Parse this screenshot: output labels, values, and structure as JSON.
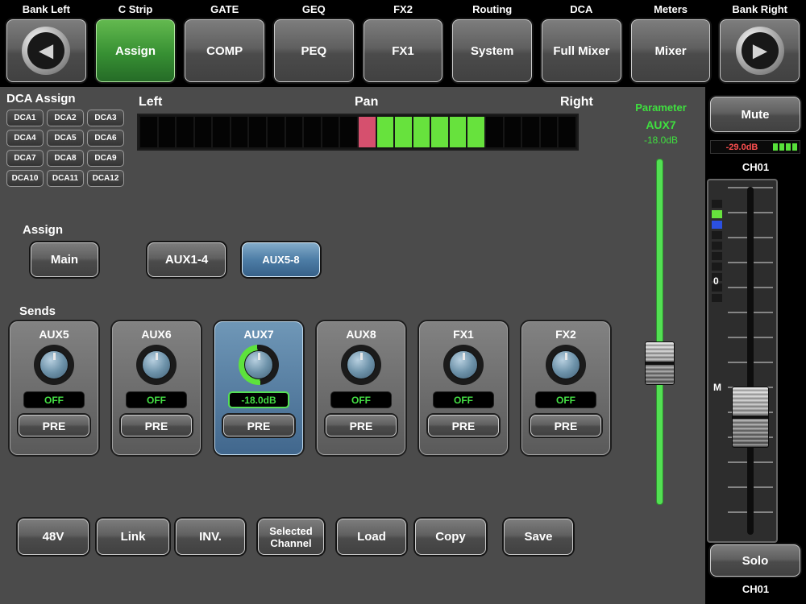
{
  "top_nav": {
    "section_labels": [
      "Bank Left",
      "C Strip",
      "GATE",
      "GEQ",
      "FX2",
      "Routing",
      "DCA",
      "Meters",
      "Bank Right"
    ],
    "buttons": [
      "Assign",
      "COMP",
      "PEQ",
      "FX1",
      "System",
      "Full Mixer",
      "Mixer"
    ],
    "selected_index": 0
  },
  "dca_assign": {
    "title": "DCA Assign",
    "buttons": [
      "DCA1",
      "DCA2",
      "DCA3",
      "DCA4",
      "DCA5",
      "DCA6",
      "DCA7",
      "DCA8",
      "DCA9",
      "DCA10",
      "DCA11",
      "DCA12"
    ]
  },
  "pan": {
    "left_label": "Left",
    "title": "Pan",
    "right_label": "Right",
    "segments": 24,
    "red_index": 12,
    "green_start": 13,
    "green_end": 18,
    "colors": {
      "off": "#040404",
      "red": "#d6506e",
      "green": "#67e23d"
    }
  },
  "parameter": {
    "label": "Parameter",
    "name": "AUX7",
    "value": "-18.0dB",
    "accent": "#3fe03f"
  },
  "assign": {
    "title": "Assign",
    "buttons": [
      {
        "label": "Main",
        "selected": false
      },
      {
        "label": "AUX1-4",
        "selected": false
      },
      {
        "label": "AUX5-8",
        "selected": true
      }
    ]
  },
  "sends": {
    "title": "Sends",
    "channels": [
      {
        "name": "AUX5",
        "value": "OFF",
        "mode": "PRE",
        "selected": false
      },
      {
        "name": "AUX6",
        "value": "OFF",
        "mode": "PRE",
        "selected": false
      },
      {
        "name": "AUX7",
        "value": "-18.0dB",
        "mode": "PRE",
        "selected": true
      },
      {
        "name": "AUX8",
        "value": "OFF",
        "mode": "PRE",
        "selected": false
      },
      {
        "name": "FX1",
        "value": "OFF",
        "mode": "PRE",
        "selected": false
      },
      {
        "name": "FX2",
        "value": "OFF",
        "mode": "PRE",
        "selected": false
      }
    ]
  },
  "bottom_bar": {
    "buttons": [
      "48V",
      "Link",
      "INV.",
      "Selected Channel",
      "Load",
      "Copy",
      "Save"
    ]
  },
  "channel_strip": {
    "mute_label": "Mute",
    "meter_value": "-29.0dB",
    "meter_segments": 4,
    "channel_top": "CH01",
    "meter_column": [
      "off",
      "green",
      "blue",
      "off",
      "off",
      "off",
      "off",
      "off",
      "off",
      "off"
    ],
    "scale_zero": "0",
    "scale_m": "M",
    "solo_label": "Solo",
    "channel_bottom": "CH01"
  }
}
